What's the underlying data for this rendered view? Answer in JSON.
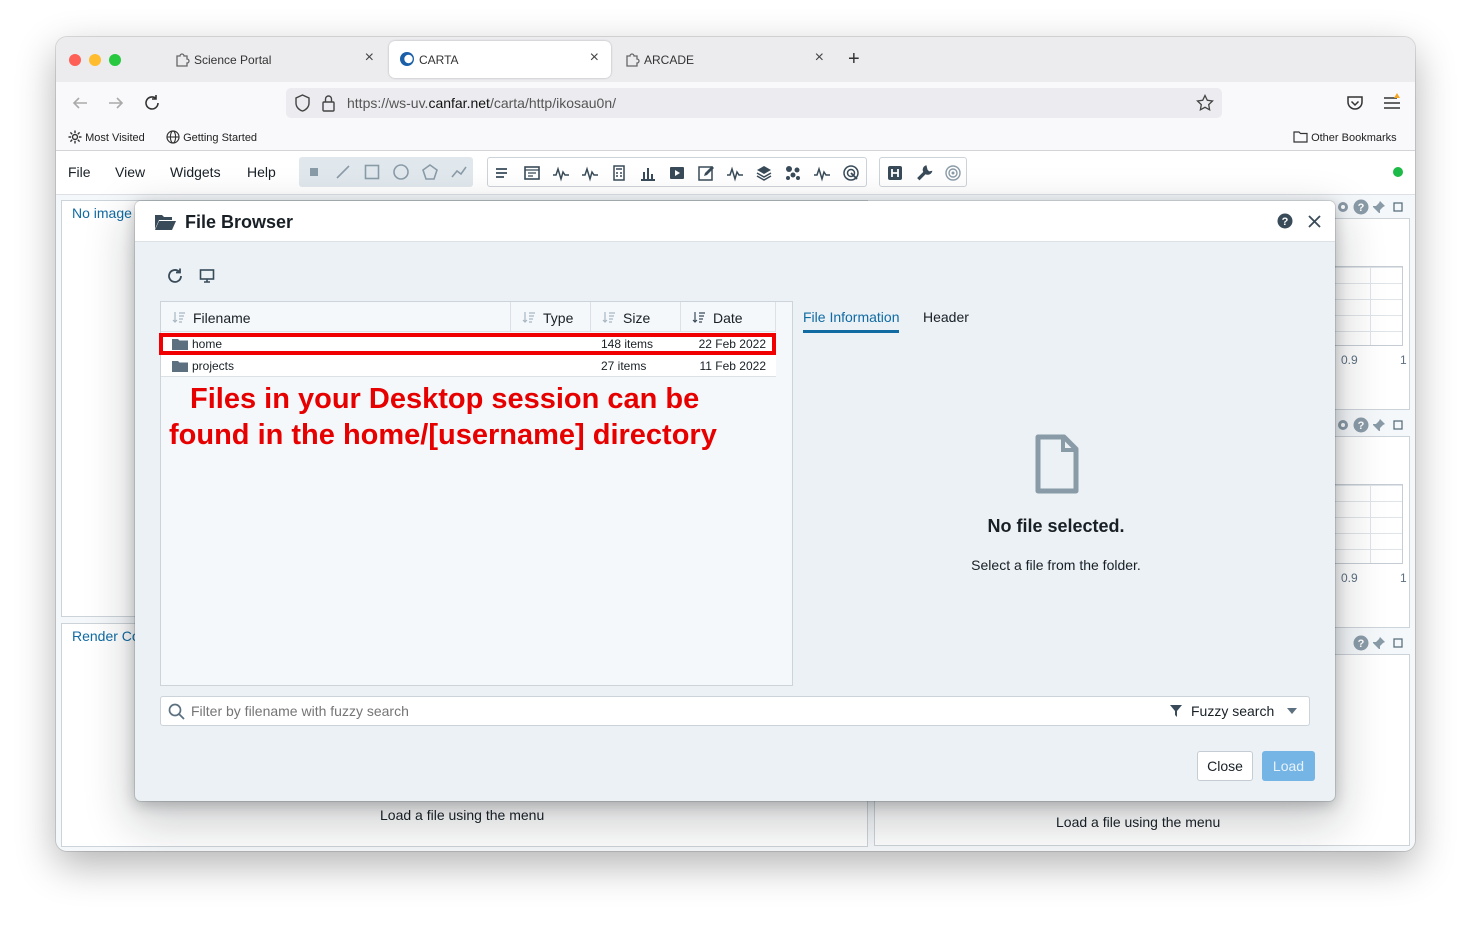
{
  "browser": {
    "tabs": [
      {
        "label": "Science Portal",
        "active": false
      },
      {
        "label": "CARTA",
        "active": true
      },
      {
        "label": "ARCADE",
        "active": false
      }
    ],
    "tab_close": "×",
    "new_tab": "+",
    "url_prefix": "https://ws-uv.",
    "url_domain": "canfar.net",
    "url_path": "/carta/http/ikosau0n/",
    "bookmarks": [
      "Most Visited",
      "Getting Started"
    ],
    "other_bookmarks": "Other Bookmarks",
    "traffic_colors": [
      "#fe5f57",
      "#febc2e",
      "#28c840"
    ]
  },
  "app": {
    "menu": [
      "File",
      "View",
      "Widgets",
      "Help"
    ],
    "status_color": "#1cba46",
    "panels": {
      "image_view_title": "No image",
      "render_config_title": "Render Co",
      "load_message_left": "Load a file using the menu",
      "load_message_right": "Load a file using the menu",
      "tick_09": "0.9",
      "tick_1": "1"
    }
  },
  "dialog": {
    "title": "File Browser",
    "columns": [
      "Filename",
      "Type",
      "Size",
      "Date"
    ],
    "files": [
      {
        "name": "home",
        "type": "",
        "size": "148 items",
        "date": "22 Feb 2022"
      },
      {
        "name": "projects",
        "type": "",
        "size": "27 items",
        "date": "11 Feb 2022"
      }
    ],
    "annotation_line1": "Files in your Desktop session can be",
    "annotation_line2": "found in the home/[username] directory",
    "info_tabs": [
      "File Information",
      "Header"
    ],
    "no_file_title": "No file selected.",
    "no_file_hint": "Select a file from the folder.",
    "filter_placeholder": "Filter by filename with fuzzy search",
    "filter_mode": "Fuzzy search",
    "close_label": "Close",
    "load_label": "Load",
    "accent": "#106ba3",
    "annotation_color": "#e60000"
  }
}
